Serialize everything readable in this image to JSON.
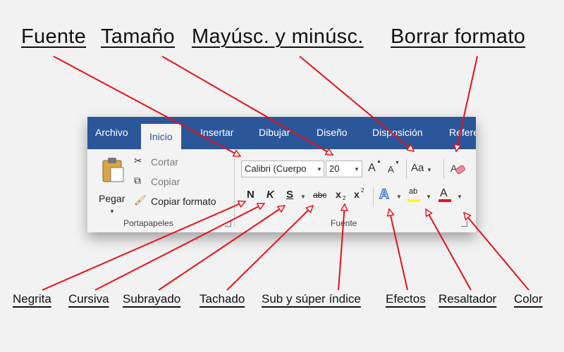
{
  "callouts_top": [
    "Fuente",
    "Tamaño",
    "Mayúsc. y minúsc.",
    "Borrar formato"
  ],
  "callouts_bottom": [
    "Negrita",
    "Cursiva",
    "Subrayado",
    "Tachado",
    "Sub y súper índice",
    "Efectos",
    "Resaltador",
    "Color"
  ],
  "tabs": [
    "Archivo",
    "Inicio",
    "Insertar",
    "Dibujar",
    "Diseño",
    "Disposición",
    "Refere"
  ],
  "clipboard": {
    "paste_label": "Pegar",
    "cut_label": "Cortar",
    "copy_label": "Copiar",
    "format_painter_label": "Copiar formato",
    "group_label": "Portapapeles"
  },
  "font": {
    "font_name": "Calibri (Cuerpo",
    "font_size": "20",
    "grow_glyph": "A",
    "shrink_glyph": "A",
    "change_case_glyph": "Aa",
    "bold_glyph": "N",
    "italic_glyph": "K",
    "underline_glyph": "S",
    "strike_glyph": "abc",
    "subscript_glyph": "x",
    "subscript_mark": "2",
    "superscript_glyph": "x",
    "superscript_mark": "2",
    "effects_glyph": "A",
    "highlight_glyph": "ab",
    "font_color_glyph": "A",
    "group_label": "Fuente"
  },
  "colors": {
    "ribbon_blue": "#2b579a",
    "arrow_red": "#e8101a",
    "highlight_yellow": "#ffff00",
    "font_color_red": "#e81123",
    "effects_blue": "#2e75d6"
  }
}
